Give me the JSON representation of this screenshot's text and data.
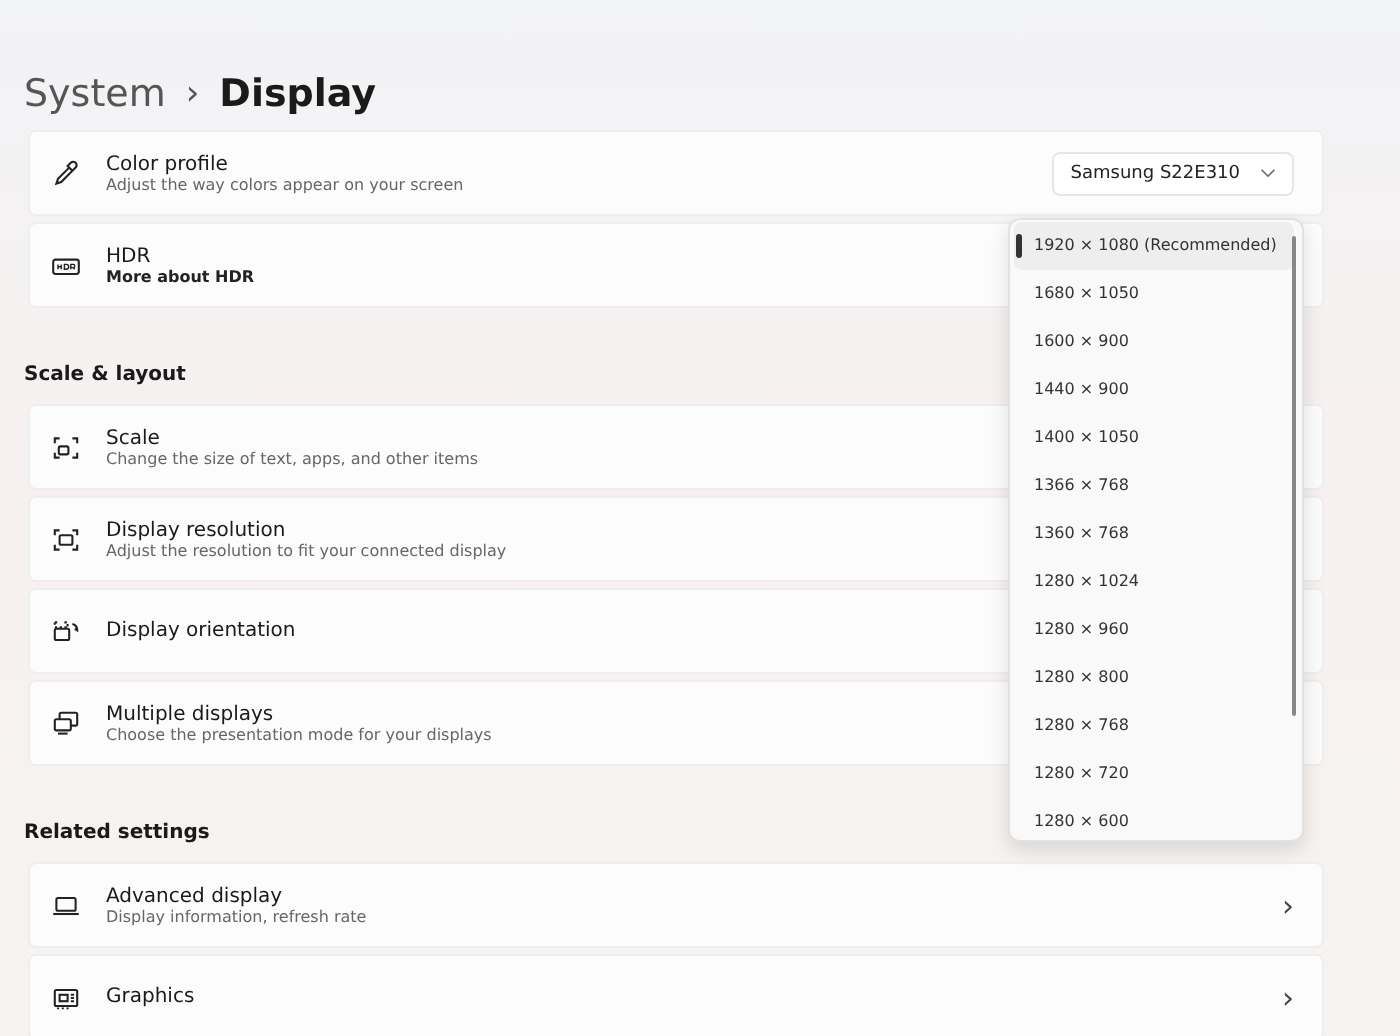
{
  "breadcrumb": {
    "parent": "System",
    "separator": "›",
    "current": "Display"
  },
  "sections": [
    {
      "rows": [
        {
          "title": "Color profile",
          "subtitle": "Adjust the way colors appear on your screen",
          "control": {
            "kind": "dropdown",
            "value": "Samsung S22E310"
          }
        },
        {
          "title": "HDR",
          "link": "More about HDR"
        }
      ]
    },
    {
      "heading": "Scale & layout",
      "rows": [
        {
          "title": "Scale",
          "subtitle": "Change the size of text, apps, and other items"
        },
        {
          "title": "Display resolution",
          "subtitle": "Adjust the resolution to fit your connected display"
        },
        {
          "title": "Display orientation"
        },
        {
          "title": "Multiple displays",
          "subtitle": "Choose the presentation mode for your displays"
        }
      ]
    },
    {
      "heading": "Related settings",
      "rows": [
        {
          "title": "Advanced display",
          "subtitle": "Display information, refresh rate",
          "control": {
            "kind": "chevron",
            "value": "›"
          }
        },
        {
          "title": "Graphics",
          "control": {
            "kind": "chevron",
            "value": "›"
          }
        }
      ]
    }
  ],
  "resolution_menu": {
    "items": [
      {
        "label": "1920 × 1080 (Recommended)",
        "selected": true
      },
      {
        "label": "1680 × 1050",
        "selected": false
      },
      {
        "label": "1600 × 900",
        "selected": false
      },
      {
        "label": "1440 × 900",
        "selected": false
      },
      {
        "label": "1400 × 1050",
        "selected": false
      },
      {
        "label": "1366 × 768",
        "selected": false
      },
      {
        "label": "1360 × 768",
        "selected": false
      },
      {
        "label": "1280 × 1024",
        "selected": false
      },
      {
        "label": "1280 × 960",
        "selected": false
      },
      {
        "label": "1280 × 800",
        "selected": false
      },
      {
        "label": "1280 × 768",
        "selected": false
      },
      {
        "label": "1280 × 720",
        "selected": false
      },
      {
        "label": "1280 × 600",
        "selected": false
      }
    ]
  }
}
